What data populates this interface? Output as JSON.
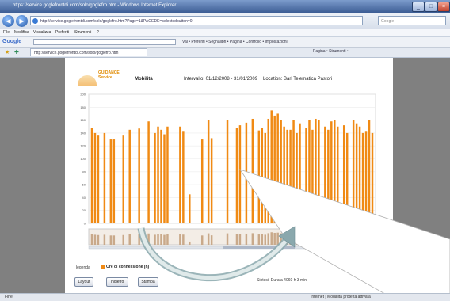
{
  "window": {
    "title": "https://service.goglefrontdi.com/solo/goglefro.htm - Windows Internet Explorer",
    "minimize": "_",
    "maximize": "□",
    "close": "×"
  },
  "address_bar": {
    "url": "http://service.goglefrontdi.com/solo/goglefro.htm?Page=1&PAGEDE=selectedbutton=0",
    "search_placeholder": "Google"
  },
  "menu": [
    "File",
    "Modifica",
    "Visualizza",
    "Preferiti",
    "Strumenti",
    "?"
  ],
  "google_toolbar": {
    "logo": "Google",
    "tools": "Vai • Preferiti • Segnalibri • Pagina • Controllo • Impostazioni"
  },
  "tabs": {
    "active_tab": "http://service.goglefrontdi.com/solo/goglefro.htm",
    "tools": "Pagina • Strumenti •"
  },
  "page": {
    "logo_text": [
      "GUIDANCE",
      "Service"
    ],
    "header": {
      "title": "Mobilità",
      "interval": "Intervallo: 01/12/2008 - 31/01/2009",
      "location": "Location: Bari Telematica Pastori"
    },
    "legend": {
      "label": "legenda",
      "entry": "Ore di connessione (h)",
      "color": "#f08a14"
    },
    "buttons": [
      "Layout",
      "Indietro",
      "Stampa"
    ],
    "status_right": "Sintesi: Durata 4060 h 3 min"
  },
  "status_bar": {
    "left": "Fine",
    "right": "Internet | Modalità protetta attivata"
  },
  "chart_data": {
    "type": "bar",
    "ylim": [
      0,
      200
    ],
    "yticks": [
      0,
      20,
      40,
      60,
      80,
      100,
      120,
      140,
      160,
      180,
      200
    ],
    "series": [
      {
        "values": [
          148,
          140,
          136,
          0,
          140,
          0,
          130,
          130,
          0,
          0,
          136,
          0,
          145,
          0,
          0,
          147,
          0,
          0,
          158,
          0,
          140,
          150,
          145,
          138,
          150,
          0,
          0,
          0,
          150,
          142,
          0,
          45,
          0,
          0,
          0,
          130,
          0,
          160,
          132,
          0,
          0,
          0,
          0,
          160,
          0,
          0,
          148,
          152,
          0,
          156,
          0,
          162,
          0,
          144,
          148,
          140,
          162,
          175,
          167,
          170,
          160,
          150,
          145,
          145,
          160,
          140,
          155,
          0,
          148,
          160,
          145,
          162,
          160,
          0,
          150,
          145,
          158,
          160,
          150,
          0,
          152,
          140,
          0,
          160,
          155,
          150,
          140,
          142,
          160,
          140
        ]
      }
    ],
    "overview_values": [
      148,
      140,
      136,
      0,
      140,
      0,
      130,
      130,
      0,
      0,
      136,
      0,
      145,
      0,
      0,
      147,
      0,
      0,
      158,
      0,
      140,
      150,
      145,
      138,
      150,
      0,
      0,
      0,
      150,
      142,
      0,
      45,
      0,
      0,
      0,
      130,
      0,
      160,
      132,
      0,
      0,
      0,
      0,
      160,
      0,
      0,
      148,
      152,
      0,
      156,
      0,
      162,
      0,
      144,
      148,
      140,
      162,
      175,
      167,
      170,
      160,
      150,
      145,
      145,
      160,
      140,
      155,
      0,
      148,
      160,
      145,
      162,
      160,
      0,
      150,
      145,
      158,
      160,
      150,
      0,
      152,
      140,
      0,
      160,
      155,
      150,
      140,
      142,
      160,
      140
    ]
  },
  "colors": {
    "bar": "#f08a14",
    "overview_bar": "#c9a98a",
    "overlay_fill": "#ffffff",
    "arrow": "#8aa8ad"
  }
}
